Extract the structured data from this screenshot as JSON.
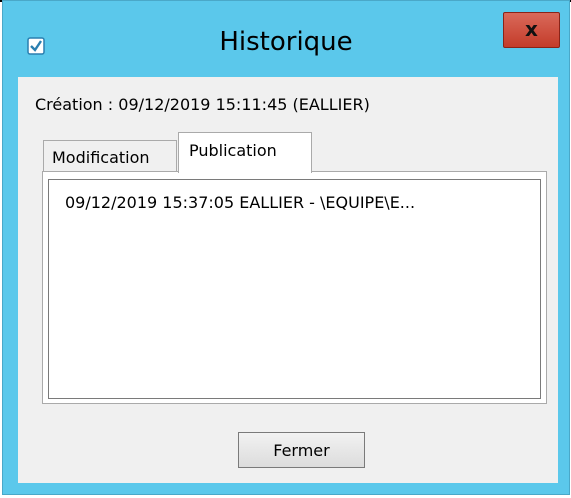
{
  "window": {
    "title": "Historique",
    "close_glyph": "x"
  },
  "creation": {
    "text": "Création : 09/12/2019 15:11:45 (EALLIER)"
  },
  "tabs": [
    {
      "label": "Modification",
      "selected": false
    },
    {
      "label": "Publication",
      "selected": true
    }
  ],
  "history_list": [
    "09/12/2019 15:37:05 EALLIER - \\EQUIPE\\E..."
  ],
  "buttons": {
    "close_label": "Fermer"
  },
  "colors": {
    "frame": "#5bc8eb",
    "close_button": "#c74634",
    "client": "#f0f0f0"
  }
}
